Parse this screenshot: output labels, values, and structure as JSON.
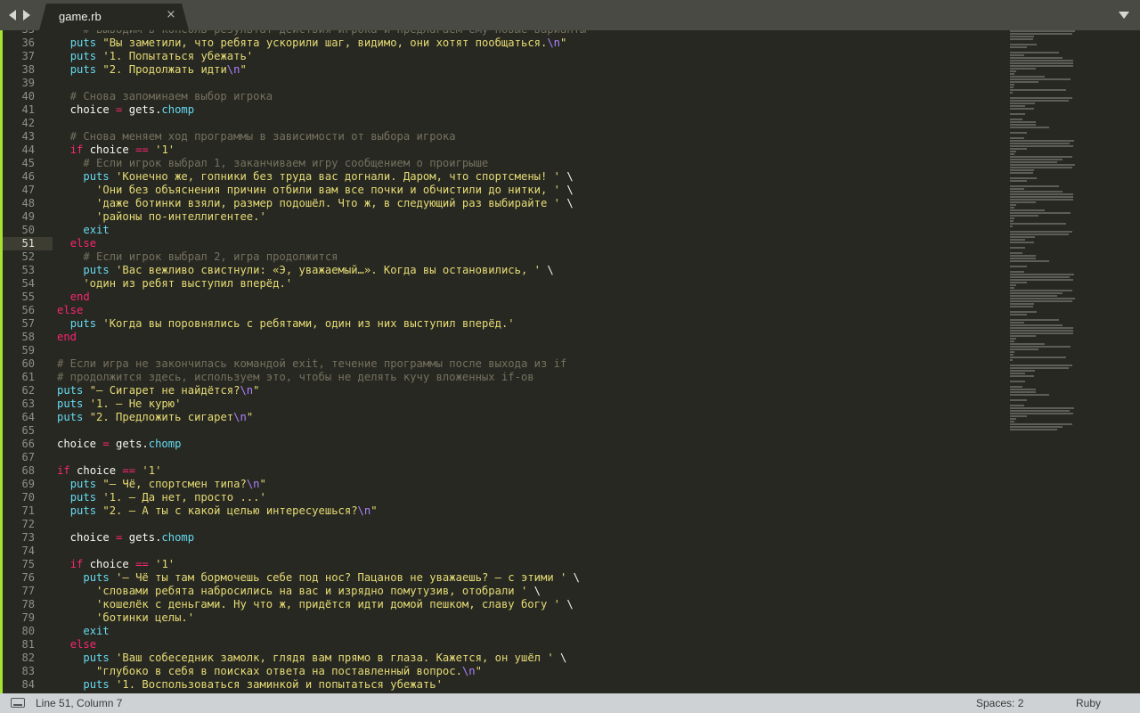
{
  "tabs": [
    {
      "label": "game.rb",
      "close_icon": "×"
    }
  ],
  "status": {
    "position": "Line 51, Column 7",
    "spaces": "Spaces: 2",
    "syntax": "Ruby"
  },
  "colors": {
    "background": "#272822",
    "comment": "#75715e",
    "keyword": "#f92672",
    "function": "#66d9ef",
    "string": "#e6db74",
    "escape": "#ae81ff",
    "gutter_modified": "#a6e22e"
  },
  "active_line": 51,
  "lines": [
    {
      "n": "35",
      "t": [
        [
          "    # Выводим в консоль результат действия игрока и предлагаем ему новые варианты",
          "c"
        ]
      ]
    },
    {
      "n": "36",
      "t": [
        [
          "  ",
          ""
        ],
        [
          "puts",
          "f"
        ],
        [
          " \"Вы заметили, что ребята ускорили шаг, видимо, они хотят пообщаться.",
          "s"
        ],
        [
          "\\n",
          "e"
        ],
        [
          "\"",
          "s"
        ]
      ]
    },
    {
      "n": "37",
      "t": [
        [
          "  ",
          ""
        ],
        [
          "puts",
          "f"
        ],
        [
          " '1. Попытаться убежать'",
          "s"
        ]
      ]
    },
    {
      "n": "38",
      "t": [
        [
          "  ",
          ""
        ],
        [
          "puts",
          "f"
        ],
        [
          " \"2. Продолжать идти",
          "s"
        ],
        [
          "\\n",
          "e"
        ],
        [
          "\"",
          "s"
        ]
      ]
    },
    {
      "n": "39",
      "t": []
    },
    {
      "n": "40",
      "t": [
        [
          "  # Снова запоминаем выбор игрока",
          "c"
        ]
      ]
    },
    {
      "n": "41",
      "t": [
        [
          "  choice ",
          ""
        ],
        [
          "=",
          "o"
        ],
        [
          " gets",
          ""
        ],
        [
          ".",
          ""
        ],
        [
          "chomp",
          "f"
        ]
      ]
    },
    {
      "n": "42",
      "t": []
    },
    {
      "n": "43",
      "t": [
        [
          "  # Снова меняем ход программы в зависимости от выбора игрока",
          "c"
        ]
      ]
    },
    {
      "n": "44",
      "t": [
        [
          "  ",
          ""
        ],
        [
          "if",
          "k"
        ],
        [
          " choice ",
          ""
        ],
        [
          "==",
          "o"
        ],
        [
          " '1'",
          "s"
        ]
      ]
    },
    {
      "n": "45",
      "t": [
        [
          "    # Если игрок выбрал 1, заканчиваем игру сообщением о проигрыше",
          "c"
        ]
      ]
    },
    {
      "n": "46",
      "t": [
        [
          "    ",
          ""
        ],
        [
          "puts",
          "f"
        ],
        [
          " 'Конечно же, гопники без труда вас догнали. Даром, что спортсмены! '",
          "s"
        ],
        [
          " \\",
          ""
        ]
      ]
    },
    {
      "n": "47",
      "t": [
        [
          "      'Они без объяснения причин отбили вам все почки и обчистили до нитки, '",
          "s"
        ],
        [
          " \\",
          ""
        ]
      ]
    },
    {
      "n": "48",
      "t": [
        [
          "      'даже ботинки взяли, размер подошёл. Что ж, в следующий раз выбирайте '",
          "s"
        ],
        [
          " \\",
          ""
        ]
      ]
    },
    {
      "n": "49",
      "t": [
        [
          "      'районы по-интеллигентее.'",
          "s"
        ]
      ]
    },
    {
      "n": "50",
      "t": [
        [
          "    ",
          ""
        ],
        [
          "exit",
          "f"
        ]
      ]
    },
    {
      "n": "51",
      "t": [
        [
          "  ",
          ""
        ],
        [
          "else",
          "k"
        ]
      ]
    },
    {
      "n": "52",
      "t": [
        [
          "    # Если игрок выбрал 2, игра продолжится",
          "c"
        ]
      ]
    },
    {
      "n": "53",
      "t": [
        [
          "    ",
          ""
        ],
        [
          "puts",
          "f"
        ],
        [
          " 'Вас вежливо свистнули: «Э, уважаемый…». Когда вы остановились, '",
          "s"
        ],
        [
          " \\",
          ""
        ]
      ]
    },
    {
      "n": "54",
      "t": [
        [
          "    'один из ребят выступил вперёд.'",
          "s"
        ]
      ]
    },
    {
      "n": "55",
      "t": [
        [
          "  ",
          ""
        ],
        [
          "end",
          "k"
        ]
      ]
    },
    {
      "n": "56",
      "t": [
        [
          "else",
          "k"
        ]
      ]
    },
    {
      "n": "57",
      "t": [
        [
          "  ",
          ""
        ],
        [
          "puts",
          "f"
        ],
        [
          " 'Когда вы поровнялись с ребятами, один из них выступил вперёд.'",
          "s"
        ]
      ]
    },
    {
      "n": "58",
      "t": [
        [
          "end",
          "k"
        ]
      ]
    },
    {
      "n": "59",
      "t": []
    },
    {
      "n": "60",
      "t": [
        [
          "# Если игра не закончилась командой exit, течение программы после выхода из if",
          "c"
        ]
      ]
    },
    {
      "n": "61",
      "t": [
        [
          "# продолжится здесь, используем это, чтобы не делять кучу вложенных if-ов",
          "c"
        ]
      ]
    },
    {
      "n": "62",
      "t": [
        [
          "puts",
          "f"
        ],
        [
          " \"— Сигарет не найдётся?",
          "s"
        ],
        [
          "\\n",
          "e"
        ],
        [
          "\"",
          "s"
        ]
      ]
    },
    {
      "n": "63",
      "t": [
        [
          "puts",
          "f"
        ],
        [
          " '1. — Не курю'",
          "s"
        ]
      ]
    },
    {
      "n": "64",
      "t": [
        [
          "puts",
          "f"
        ],
        [
          " \"2. Предложить сигарет",
          "s"
        ],
        [
          "\\n",
          "e"
        ],
        [
          "\"",
          "s"
        ]
      ]
    },
    {
      "n": "65",
      "t": []
    },
    {
      "n": "66",
      "t": [
        [
          "choice ",
          ""
        ],
        [
          "=",
          "o"
        ],
        [
          " gets",
          ""
        ],
        [
          ".",
          ""
        ],
        [
          "chomp",
          "f"
        ]
      ]
    },
    {
      "n": "67",
      "t": []
    },
    {
      "n": "68",
      "t": [
        [
          "if",
          "k"
        ],
        [
          " choice ",
          ""
        ],
        [
          "==",
          "o"
        ],
        [
          " '1'",
          "s"
        ]
      ]
    },
    {
      "n": "69",
      "t": [
        [
          "  ",
          ""
        ],
        [
          "puts",
          "f"
        ],
        [
          " \"— Чё, спортсмен типа?",
          "s"
        ],
        [
          "\\n",
          "e"
        ],
        [
          "\"",
          "s"
        ]
      ]
    },
    {
      "n": "70",
      "t": [
        [
          "  ",
          ""
        ],
        [
          "puts",
          "f"
        ],
        [
          " '1. — Да нет, просто ...'",
          "s"
        ]
      ]
    },
    {
      "n": "71",
      "t": [
        [
          "  ",
          ""
        ],
        [
          "puts",
          "f"
        ],
        [
          " \"2. — А ты с какой целью интересуешься?",
          "s"
        ],
        [
          "\\n",
          "e"
        ],
        [
          "\"",
          "s"
        ]
      ]
    },
    {
      "n": "72",
      "t": []
    },
    {
      "n": "73",
      "t": [
        [
          "  choice ",
          ""
        ],
        [
          "=",
          "o"
        ],
        [
          " gets",
          ""
        ],
        [
          ".",
          ""
        ],
        [
          "chomp",
          "f"
        ]
      ]
    },
    {
      "n": "74",
      "t": []
    },
    {
      "n": "75",
      "t": [
        [
          "  ",
          ""
        ],
        [
          "if",
          "k"
        ],
        [
          " choice ",
          ""
        ],
        [
          "==",
          "o"
        ],
        [
          " '1'",
          "s"
        ]
      ]
    },
    {
      "n": "76",
      "t": [
        [
          "    ",
          ""
        ],
        [
          "puts",
          "f"
        ],
        [
          " '— Чё ты там бормочешь себе под нос? Пацанов не уважаешь? — с этими '",
          "s"
        ],
        [
          " \\",
          ""
        ]
      ]
    },
    {
      "n": "77",
      "t": [
        [
          "      'словами ребята набросились на вас и изрядно помутузив, отобрали '",
          "s"
        ],
        [
          " \\",
          ""
        ]
      ]
    },
    {
      "n": "78",
      "t": [
        [
          "      'кошелёк с деньгами. Ну что ж, придётся идти домой пешком, славу богу '",
          "s"
        ],
        [
          " \\",
          ""
        ]
      ]
    },
    {
      "n": "79",
      "t": [
        [
          "      'ботинки целы.'",
          "s"
        ]
      ]
    },
    {
      "n": "80",
      "t": [
        [
          "    ",
          ""
        ],
        [
          "exit",
          "f"
        ]
      ]
    },
    {
      "n": "81",
      "t": [
        [
          "  ",
          ""
        ],
        [
          "else",
          "k"
        ]
      ]
    },
    {
      "n": "82",
      "t": [
        [
          "    ",
          ""
        ],
        [
          "puts",
          "f"
        ],
        [
          " 'Ваш собеседник замолк, глядя вам прямо в глаза. Кажется, он ушёл '",
          "s"
        ],
        [
          " \\",
          ""
        ]
      ]
    },
    {
      "n": "83",
      "t": [
        [
          "      \"глубоко в себя в поисках ответа на поставленный вопрос.",
          "s"
        ],
        [
          "\\n",
          "e"
        ],
        [
          "\"",
          "s"
        ]
      ]
    },
    {
      "n": "84",
      "t": [
        [
          "    ",
          ""
        ],
        [
          "puts",
          "f"
        ],
        [
          " '1. Воспользоваться заминкой и попытаться убежать'",
          "s"
        ]
      ]
    }
  ]
}
